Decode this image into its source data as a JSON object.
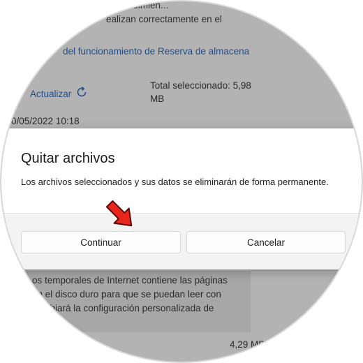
{
  "background": {
    "line1": "un rendimien...",
    "line2": "ealizan correctamente en el",
    "link": "del funcionamiento de Reserva de almacena",
    "refresh_label": "Actualizar",
    "total_line1": "Total seleccionado: 5,98",
    "total_line2": "MB",
    "date": "0/05/2022 10:18",
    "desc_line1": "os temporales de Internet contiene las páginas",
    "desc_line2": "en el disco duro para que se puedan leer con",
    "desc_line3": "cambiará la configuración personalizada de",
    "size": "4,29 MB"
  },
  "dialog": {
    "title": "Quitar archivos",
    "message": "Los archivos seleccionados y sus datos se eliminarán de forma permanente.",
    "continue_label": "Continuar",
    "cancel_label": "Cancelar"
  },
  "colors": {
    "overlay": "#b3b3b3",
    "link": "#1f4e8a",
    "arrow": "#e8261c"
  },
  "icons": [
    "refresh-icon",
    "red-arrow-annotation"
  ]
}
